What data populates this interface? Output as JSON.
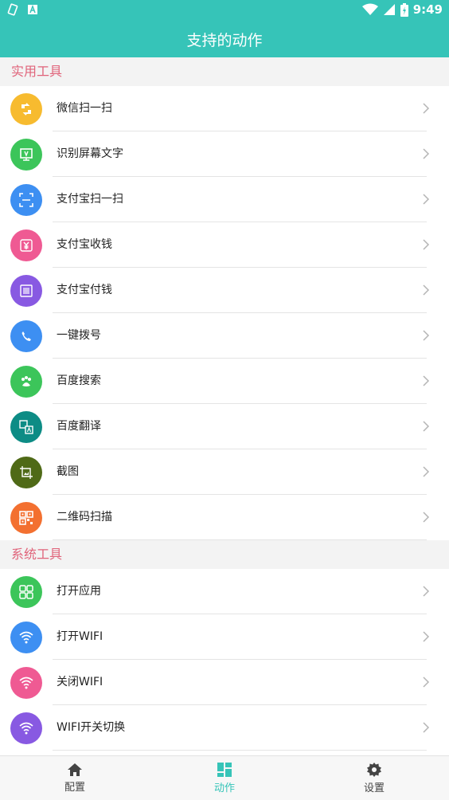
{
  "status_bar": {
    "time": "9:49",
    "left_icons": [
      "rotate-icon",
      "notification-a-icon"
    ],
    "right_icons": [
      "wifi-icon",
      "signal-icon",
      "battery-icon"
    ]
  },
  "app_bar": {
    "title": "支持的动作"
  },
  "sections": [
    {
      "title": "实用工具",
      "items": [
        {
          "label": "微信扫一扫",
          "icon": "wechat-scan-icon",
          "color": "#f7bb2f"
        },
        {
          "label": "识别屏幕文字",
          "icon": "text-recognize-icon",
          "color": "#3cc55a"
        },
        {
          "label": "支付宝扫一扫",
          "icon": "scan-frame-icon",
          "color": "#3d8ff2"
        },
        {
          "label": "支付宝收钱",
          "icon": "yuan-receive-icon",
          "color": "#ef5a93"
        },
        {
          "label": "支付宝付钱",
          "icon": "barcode-icon",
          "color": "#8859e2"
        },
        {
          "label": "一键拨号",
          "icon": "phone-icon",
          "color": "#3d8ff2"
        },
        {
          "label": "百度搜索",
          "icon": "paw-icon",
          "color": "#3cc55a"
        },
        {
          "label": "百度翻译",
          "icon": "translate-icon",
          "color": "#0d8c85"
        },
        {
          "label": "截图",
          "icon": "screenshot-icon",
          "color": "#4f6a17"
        },
        {
          "label": "二维码扫描",
          "icon": "qrcode-icon",
          "color": "#f37030"
        }
      ]
    },
    {
      "title": "系统工具",
      "items": [
        {
          "label": "打开应用",
          "icon": "apps-grid-icon",
          "color": "#3cc55a"
        },
        {
          "label": "打开WIFI",
          "icon": "wifi-on-icon",
          "color": "#3d8ff2"
        },
        {
          "label": "关闭WIFI",
          "icon": "wifi-off-icon",
          "color": "#ef5a93"
        },
        {
          "label": "WIFI开关切换",
          "icon": "wifi-toggle-icon",
          "color": "#8859e2"
        }
      ]
    }
  ],
  "bottom_nav": [
    {
      "label": "配置",
      "icon": "home-icon",
      "active": false
    },
    {
      "label": "动作",
      "icon": "dashboard-icon",
      "active": true
    },
    {
      "label": "设置",
      "icon": "gear-icon",
      "active": false
    }
  ],
  "colors": {
    "accent": "#36c4b8",
    "section_title": "#e0637a"
  }
}
